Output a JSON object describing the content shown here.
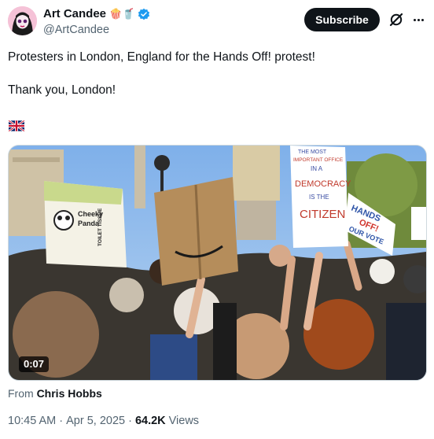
{
  "author": {
    "display_name": "Art Candee",
    "badges": "🍿🥤",
    "handle": "@ArtCandee",
    "verified_icon": "verified-badge-icon"
  },
  "header": {
    "subscribe_label": "Subscribe"
  },
  "post": {
    "line1": "Protesters in London, England for the Hands Off! protest!",
    "line2": "Thank you, London!",
    "flag": "🇬🇧"
  },
  "video": {
    "duration": "0:07",
    "signs": {
      "democracy_1": "THE MOST",
      "democracy_2": "IMPORTANT OFFICE",
      "democracy_3": "IN A",
      "democracy_4": "DEMOCRACY",
      "democracy_5": "IS THE",
      "democracy_6": "CITIZEN",
      "hands_1": "HANDS",
      "hands_2": "OFF!",
      "hands_3": "OUR VOTE",
      "panda_1": "Cheeky",
      "panda_2": "Panda",
      "panda_3": "TOILET TISSUE"
    }
  },
  "source": {
    "prefix": "From",
    "name": "Chris Hobbs"
  },
  "meta": {
    "time": "10:45 AM",
    "sep": "·",
    "date": "Apr 5, 2025",
    "sep2": "·",
    "views_count": "64.2K",
    "views_label": "Views"
  },
  "colors": {
    "brand_dark": "#0f1419",
    "secondary_text": "#536471",
    "verified_blue": "#1d9bf0",
    "sky": "#8bb7e8"
  }
}
